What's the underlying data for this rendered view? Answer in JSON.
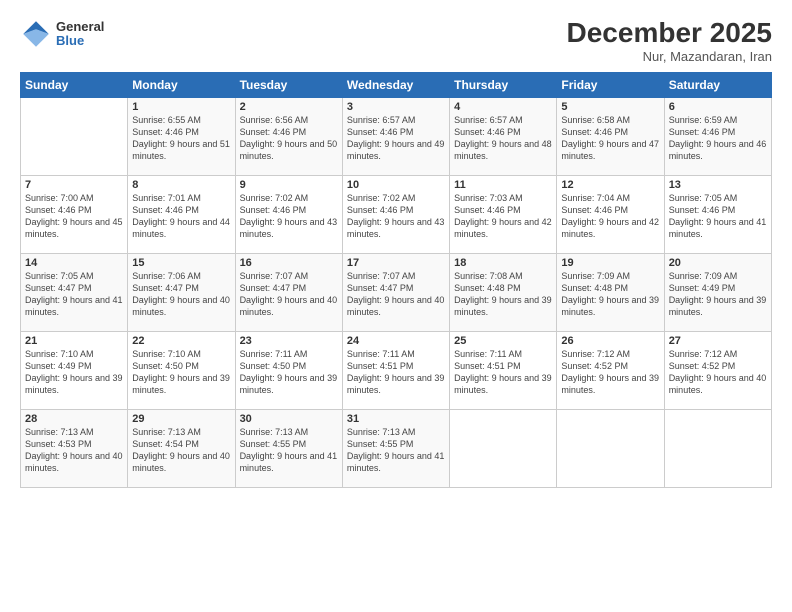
{
  "logo": {
    "general": "General",
    "blue": "Blue"
  },
  "header": {
    "month": "December 2025",
    "location": "Nur, Mazandaran, Iran"
  },
  "days_of_week": [
    "Sunday",
    "Monday",
    "Tuesday",
    "Wednesday",
    "Thursday",
    "Friday",
    "Saturday"
  ],
  "weeks": [
    [
      {
        "day": "",
        "content": ""
      },
      {
        "day": "1",
        "content": "Sunrise: 6:55 AM\nSunset: 4:46 PM\nDaylight: 9 hours\nand 51 minutes."
      },
      {
        "day": "2",
        "content": "Sunrise: 6:56 AM\nSunset: 4:46 PM\nDaylight: 9 hours\nand 50 minutes."
      },
      {
        "day": "3",
        "content": "Sunrise: 6:57 AM\nSunset: 4:46 PM\nDaylight: 9 hours\nand 49 minutes."
      },
      {
        "day": "4",
        "content": "Sunrise: 6:57 AM\nSunset: 4:46 PM\nDaylight: 9 hours\nand 48 minutes."
      },
      {
        "day": "5",
        "content": "Sunrise: 6:58 AM\nSunset: 4:46 PM\nDaylight: 9 hours\nand 47 minutes."
      },
      {
        "day": "6",
        "content": "Sunrise: 6:59 AM\nSunset: 4:46 PM\nDaylight: 9 hours\nand 46 minutes."
      }
    ],
    [
      {
        "day": "7",
        "content": ""
      },
      {
        "day": "8",
        "content": "Sunrise: 7:01 AM\nSunset: 4:46 PM\nDaylight: 9 hours\nand 44 minutes."
      },
      {
        "day": "9",
        "content": "Sunrise: 7:02 AM\nSunset: 4:46 PM\nDaylight: 9 hours\nand 43 minutes."
      },
      {
        "day": "10",
        "content": "Sunrise: 7:02 AM\nSunset: 4:46 PM\nDaylight: 9 hours\nand 43 minutes."
      },
      {
        "day": "11",
        "content": "Sunrise: 7:03 AM\nSunset: 4:46 PM\nDaylight: 9 hours\nand 42 minutes."
      },
      {
        "day": "12",
        "content": "Sunrise: 7:04 AM\nSunset: 4:46 PM\nDaylight: 9 hours\nand 42 minutes."
      },
      {
        "day": "13",
        "content": "Sunrise: 7:05 AM\nSunset: 4:46 PM\nDaylight: 9 hours\nand 41 minutes."
      }
    ],
    [
      {
        "day": "14",
        "content": ""
      },
      {
        "day": "15",
        "content": "Sunrise: 7:06 AM\nSunset: 4:47 PM\nDaylight: 9 hours\nand 40 minutes."
      },
      {
        "day": "16",
        "content": "Sunrise: 7:07 AM\nSunset: 4:47 PM\nDaylight: 9 hours\nand 40 minutes."
      },
      {
        "day": "17",
        "content": "Sunrise: 7:07 AM\nSunset: 4:47 PM\nDaylight: 9 hours\nand 40 minutes."
      },
      {
        "day": "18",
        "content": "Sunrise: 7:08 AM\nSunset: 4:48 PM\nDaylight: 9 hours\nand 39 minutes."
      },
      {
        "day": "19",
        "content": "Sunrise: 7:09 AM\nSunset: 4:48 PM\nDaylight: 9 hours\nand 39 minutes."
      },
      {
        "day": "20",
        "content": "Sunrise: 7:09 AM\nSunset: 4:49 PM\nDaylight: 9 hours\nand 39 minutes."
      }
    ],
    [
      {
        "day": "21",
        "content": ""
      },
      {
        "day": "22",
        "content": "Sunrise: 7:10 AM\nSunset: 4:50 PM\nDaylight: 9 hours\nand 39 minutes."
      },
      {
        "day": "23",
        "content": "Sunrise: 7:11 AM\nSunset: 4:50 PM\nDaylight: 9 hours\nand 39 minutes."
      },
      {
        "day": "24",
        "content": "Sunrise: 7:11 AM\nSunset: 4:51 PM\nDaylight: 9 hours\nand 39 minutes."
      },
      {
        "day": "25",
        "content": "Sunrise: 7:11 AM\nSunset: 4:51 PM\nDaylight: 9 hours\nand 39 minutes."
      },
      {
        "day": "26",
        "content": "Sunrise: 7:12 AM\nSunset: 4:52 PM\nDaylight: 9 hours\nand 39 minutes."
      },
      {
        "day": "27",
        "content": "Sunrise: 7:12 AM\nSunset: 4:52 PM\nDaylight: 9 hours\nand 40 minutes."
      }
    ],
    [
      {
        "day": "28",
        "content": "Sunrise: 7:13 AM\nSunset: 4:53 PM\nDaylight: 9 hours\nand 40 minutes."
      },
      {
        "day": "29",
        "content": "Sunrise: 7:13 AM\nSunset: 4:54 PM\nDaylight: 9 hours\nand 40 minutes."
      },
      {
        "day": "30",
        "content": "Sunrise: 7:13 AM\nSunset: 4:55 PM\nDaylight: 9 hours\nand 41 minutes."
      },
      {
        "day": "31",
        "content": "Sunrise: 7:13 AM\nSunset: 4:55 PM\nDaylight: 9 hours\nand 41 minutes."
      },
      {
        "day": "",
        "content": ""
      },
      {
        "day": "",
        "content": ""
      },
      {
        "day": "",
        "content": ""
      }
    ]
  ],
  "week_7_day7_content": "Sunrise: 7:00 AM\nSunset: 4:46 PM\nDaylight: 9 hours\nand 45 minutes.",
  "week_14_day14_content": "Sunrise: 7:05 AM\nSunset: 4:47 PM\nDaylight: 9 hours\nand 41 minutes.",
  "week_21_day21_content": "Sunrise: 7:10 AM\nSunset: 4:49 PM\nDaylight: 9 hours\nand 39 minutes."
}
